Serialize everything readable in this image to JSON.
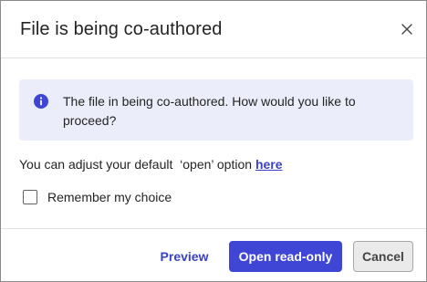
{
  "dialog": {
    "title": "File is being co-authored",
    "close_icon": "close-icon",
    "info_icon": "info-icon",
    "info_message": "The file in being co-authored. How would you like to proceed?",
    "adjust_text": "You can adjust your default  ‘open’ option ",
    "adjust_link": "here",
    "remember_label": "Remember my choice",
    "remember_checked": false
  },
  "footer": {
    "preview_label": "Preview",
    "open_readonly_label": "Open read-only",
    "cancel_label": "Cancel"
  },
  "colors": {
    "accent": "#3f46d6",
    "link": "#3b42c4",
    "info_background": "#ebedfa"
  }
}
